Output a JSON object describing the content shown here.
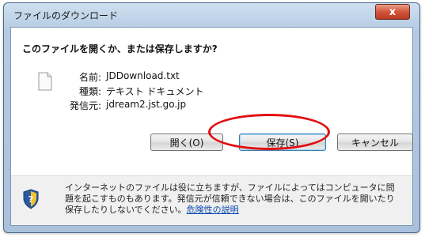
{
  "window": {
    "title": "ファイルのダウンロード",
    "close_label": "x"
  },
  "dialog": {
    "question": "このファイルを開くか、または保存しますか?",
    "file": {
      "name_label": "名前:",
      "name_value": "JDDownload.txt",
      "type_label": "種類:",
      "type_value": "テキスト ドキュメント",
      "from_label": "発信元:",
      "from_value": "jdream2.jst.go.jp"
    },
    "buttons": {
      "open": "開く(O)",
      "save": "保存(S)",
      "cancel": "キャンセル"
    }
  },
  "footer": {
    "warning_text": "インターネットのファイルは役に立ちますが、ファイルによってはコンピュータに問題を起こすものもあります。発信元が信頼できない場合は、このファイルを開いたり保存したりしないでください。",
    "risk_link": "危険性の説明"
  },
  "colors": {
    "highlight": "#e01010",
    "link": "#0645ad",
    "close_button": "#c94a30"
  },
  "icons": [
    "close-icon",
    "file-icon",
    "shield-icon"
  ]
}
